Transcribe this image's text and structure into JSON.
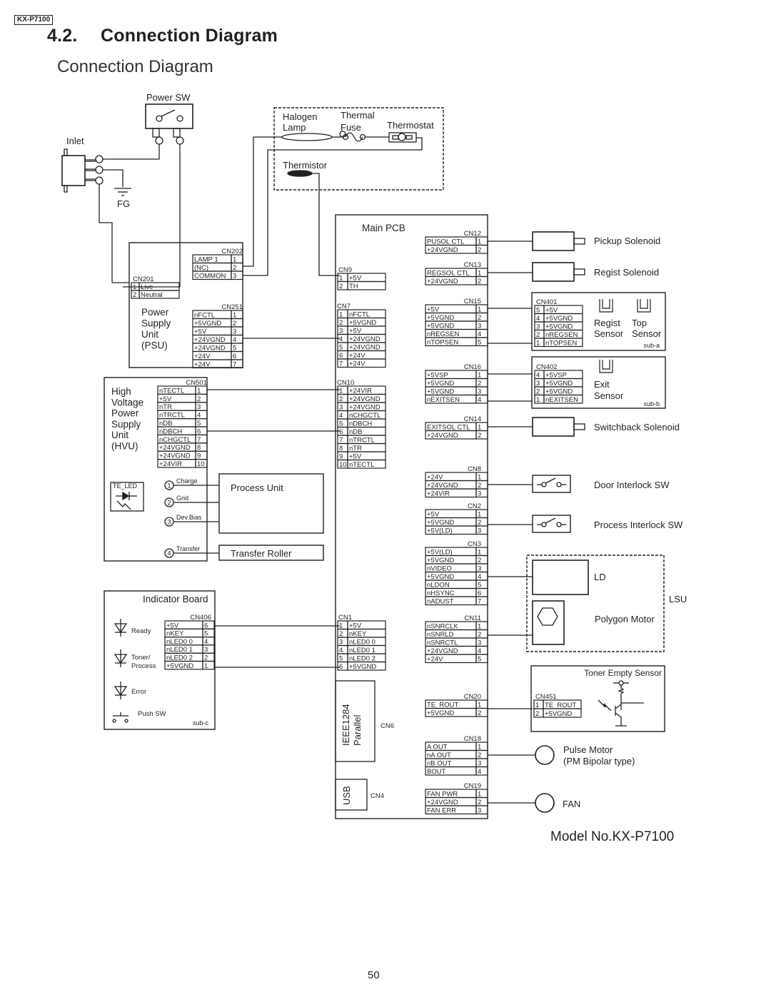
{
  "header": {
    "model_tag": "KX-P7100",
    "section_number": "4.2.",
    "section_title": "Connection Diagram",
    "subtitle": "Connection Diagram"
  },
  "footer": {
    "model_no": "Model No.KX-P7100",
    "page_number": "50"
  },
  "top_components": {
    "power_sw": "Power SW",
    "inlet": "Inlet",
    "fg": "FG",
    "halogen": [
      "Halogen",
      "Lamp"
    ],
    "thermal_fuse": [
      "Thermal",
      "Fuse"
    ],
    "thermostat": "Thermostat",
    "thermistor": "Thermistor"
  },
  "psu": {
    "label": [
      "Power",
      "Supply",
      "Unit",
      "(PSU)"
    ],
    "connectors": [
      {
        "name": "CN202",
        "pins": [
          [
            "LAMP 1",
            "1"
          ],
          [
            "(NC)",
            "2"
          ],
          [
            "COMMON",
            "3"
          ]
        ]
      },
      {
        "name": "CN201",
        "pins": [
          [
            "1",
            "Live"
          ],
          [
            "2",
            "Neutral"
          ]
        ]
      },
      {
        "name": "CN251",
        "pins": [
          [
            "nFCTL",
            "1"
          ],
          [
            "+5VGND",
            "2"
          ],
          [
            "+5V",
            "3"
          ],
          [
            "+24VGND",
            "4"
          ],
          [
            "+24VGND",
            "5"
          ],
          [
            "+24V",
            "6"
          ],
          [
            "+24V",
            "7"
          ]
        ]
      }
    ]
  },
  "hvu": {
    "label": [
      "High",
      "Voltage",
      "Power",
      "Supply",
      "Unit",
      "(HVU)"
    ],
    "connector": {
      "name": "CN501",
      "pins": [
        [
          "nTECTL",
          "1"
        ],
        [
          "+5V",
          "2"
        ],
        [
          "nTR",
          "3"
        ],
        [
          "nTRCTL",
          "4"
        ],
        [
          "nDB",
          "5"
        ],
        [
          "nDBCH",
          "6"
        ],
        [
          "nCHGCTL",
          "7"
        ],
        [
          "+24VGND",
          "8"
        ],
        [
          "+24VGND",
          "9"
        ],
        [
          "+24VIR",
          "10"
        ]
      ]
    },
    "te_led": "TE_LED",
    "outputs": [
      {
        "num": "1",
        "label": "Charge"
      },
      {
        "num": "2",
        "label": "Grid"
      },
      {
        "num": "3",
        "label": "Dev.Bias"
      },
      {
        "num": "4",
        "label": "Transfer"
      }
    ],
    "process_unit": "Process Unit",
    "transfer_roller": "Transfer Roller"
  },
  "indicator": {
    "title": "Indicator Board",
    "connector": {
      "name": "CN406",
      "pins": [
        [
          "+5V",
          "6"
        ],
        [
          "nKEY",
          "5"
        ],
        [
          "nLED0 0",
          "4"
        ],
        [
          "nLED0 1",
          "3"
        ],
        [
          "nLED0 2",
          "2"
        ],
        [
          "+5VGND",
          "1"
        ]
      ]
    },
    "leds": [
      [
        "Ready"
      ],
      [
        "Toner/",
        "Process"
      ],
      [
        "Error"
      ]
    ],
    "push_sw": "Push SW",
    "sub": "sub-c"
  },
  "main_pcb": {
    "title": "Main PCB",
    "left_connectors": [
      {
        "name": "CN9",
        "pins": [
          [
            "1",
            "+5V"
          ],
          [
            "2",
            "TH"
          ]
        ]
      },
      {
        "name": "CN7",
        "pins": [
          [
            "1",
            "nFCTL"
          ],
          [
            "2",
            "+5VGND"
          ],
          [
            "3",
            "+5V"
          ],
          [
            "4",
            "+24VGND"
          ],
          [
            "5",
            "+24VGND"
          ],
          [
            "6",
            "+24V"
          ],
          [
            "7",
            "+24V"
          ]
        ]
      },
      {
        "name": "CN10",
        "pins": [
          [
            "1",
            "+24VIR"
          ],
          [
            "2",
            "+24VGND"
          ],
          [
            "3",
            "+24VGND"
          ],
          [
            "4",
            "nCHGCTL"
          ],
          [
            "5",
            "nDBCH"
          ],
          [
            "6",
            "nDB"
          ],
          [
            "7",
            "nTRCTL"
          ],
          [
            "8",
            "nTR"
          ],
          [
            "9",
            "+5V"
          ],
          [
            "10",
            "nTECTL"
          ]
        ]
      },
      {
        "name": "CN1",
        "pins": [
          [
            "1",
            "+5V"
          ],
          [
            "2",
            "nKEY"
          ],
          [
            "3",
            "nLED0 0"
          ],
          [
            "4",
            "nLED0 1"
          ],
          [
            "5",
            "nLED0 2"
          ],
          [
            "6",
            "+5VGND"
          ]
        ]
      }
    ],
    "ieee": [
      "IEEE1284",
      "Parallel"
    ],
    "cn6": "CN6",
    "usb": "USB",
    "cn4": "CN4",
    "right_connectors": [
      {
        "name": "CN12",
        "pins": [
          [
            "PUSOL CTL",
            "1"
          ],
          [
            "+24VGND",
            "2"
          ]
        ]
      },
      {
        "name": "CN13",
        "pins": [
          [
            "REGSOL CTL",
            "1"
          ],
          [
            "+24VGND",
            "2"
          ]
        ]
      },
      {
        "name": "CN15",
        "pins": [
          [
            "+5V",
            "1"
          ],
          [
            "+5VGND",
            "2"
          ],
          [
            "+5VGND",
            "3"
          ],
          [
            "nREGSEN",
            "4"
          ],
          [
            "nTOPSEN",
            "5"
          ]
        ]
      },
      {
        "name": "CN16",
        "pins": [
          [
            "+5VSP",
            "1"
          ],
          [
            "+5VGND",
            "2"
          ],
          [
            "+5VGND",
            "3"
          ],
          [
            "nEXITSEN",
            "4"
          ]
        ]
      },
      {
        "name": "CN14",
        "pins": [
          [
            "EXITSOL CTL",
            "1"
          ],
          [
            "+24VGND",
            "2"
          ]
        ]
      },
      {
        "name": "CN8",
        "pins": [
          [
            "+24V",
            "1"
          ],
          [
            "+24VGND",
            "2"
          ],
          [
            "+24VIR",
            "3"
          ]
        ]
      },
      {
        "name": "CN2",
        "pins": [
          [
            "+5V",
            "1"
          ],
          [
            "+5VGND",
            "2"
          ],
          [
            "+5V(LD)",
            "3"
          ]
        ]
      },
      {
        "name": "CN3",
        "pins": [
          [
            "+5V(LD)",
            "1"
          ],
          [
            "+5VGND",
            "2"
          ],
          [
            "nVIDEO",
            "3"
          ],
          [
            "+5VGND",
            "4"
          ],
          [
            "nLDON",
            "5"
          ],
          [
            "nHSYNC",
            "6"
          ],
          [
            "nADUST",
            "7"
          ]
        ]
      },
      {
        "name": "CN11",
        "pins": [
          [
            "nSNRCLK",
            "1"
          ],
          [
            "nSNRLD",
            "2"
          ],
          [
            "nSNRCTL",
            "3"
          ],
          [
            "+24VGND",
            "4"
          ],
          [
            "+24V",
            "5"
          ]
        ]
      },
      {
        "name": "CN20",
        "pins": [
          [
            "TE_ROUT",
            "1"
          ],
          [
            "+5VGND",
            "2"
          ]
        ]
      },
      {
        "name": "CN18",
        "pins": [
          [
            "A OUT",
            "1"
          ],
          [
            "nA OUT",
            "2"
          ],
          [
            "nB OUT",
            "3"
          ],
          [
            "BOUT",
            "4"
          ]
        ]
      },
      {
        "name": "CN19",
        "pins": [
          [
            "FAN PWR",
            "1"
          ],
          [
            "+24VGND",
            "2"
          ],
          [
            "FAN ERR",
            "3"
          ]
        ]
      }
    ]
  },
  "peripherals": {
    "pickup_solenoid": "Pickup Solenoid",
    "regist_solenoid": "Regist Solenoid",
    "sensor_board_a": {
      "connector": {
        "name": "CN401",
        "pins": [
          [
            "5",
            "+5V"
          ],
          [
            "4",
            "+5VGND"
          ],
          [
            "3",
            "+5VGND"
          ],
          [
            "2",
            "nREGSEN"
          ],
          [
            "1",
            "nTOPSEN"
          ]
        ]
      },
      "regist_sensor": [
        "Regist",
        "Sensor"
      ],
      "top_sensor": [
        "Top",
        "Sensor"
      ],
      "sub": "sub-a"
    },
    "sensor_board_b": {
      "connector": {
        "name": "CN402",
        "pins": [
          [
            "4",
            "+5VSP"
          ],
          [
            "3",
            "+5VGND"
          ],
          [
            "2",
            "+5VGND"
          ],
          [
            "1",
            "nEXITSEN"
          ]
        ]
      },
      "exit_sensor": [
        "Exit",
        "Sensor"
      ],
      "sub": "sub-b"
    },
    "switchback_solenoid": "Switchback Solenoid",
    "door_interlock": "Door Interlock SW",
    "process_interlock": "Process Interlock SW",
    "ld": "LD",
    "polygon_motor": "Polygon Motor",
    "lsu": "LSU",
    "toner_sensor": {
      "title": "Toner Empty Sensor",
      "connector": {
        "name": "CN451",
        "pins": [
          [
            "1",
            "TE_ROUT"
          ],
          [
            "2",
            "+5VGND"
          ]
        ]
      }
    },
    "pulse_motor": [
      "Pulse Motor",
      "(PM Bipolar type)"
    ],
    "fan": "FAN"
  }
}
